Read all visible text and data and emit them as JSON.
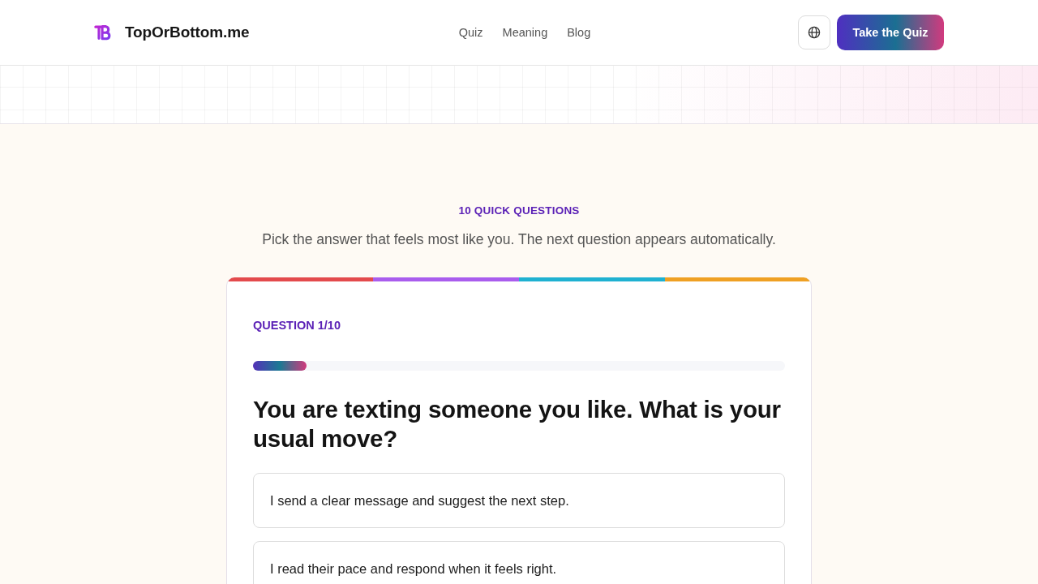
{
  "header": {
    "brand": "TopOrBottom.me",
    "nav": [
      "Quiz",
      "Meaning",
      "Blog"
    ],
    "cta": "Take the Quiz"
  },
  "intro": {
    "eyebrow": "10 QUICK QUESTIONS",
    "subtitle": "Pick the answer that feels most like you. The next question appears automatically."
  },
  "quiz": {
    "counter": "QUESTION 1/10",
    "progress": {
      "level": 0.1
    },
    "question": "You are texting someone you like. What is your usual move?",
    "options": [
      {
        "text": "I send a clear message and suggest the next step.",
        "selected": false
      },
      {
        "text": "I read their pace and respond when it feels right.",
        "selected": false
      }
    ]
  }
}
